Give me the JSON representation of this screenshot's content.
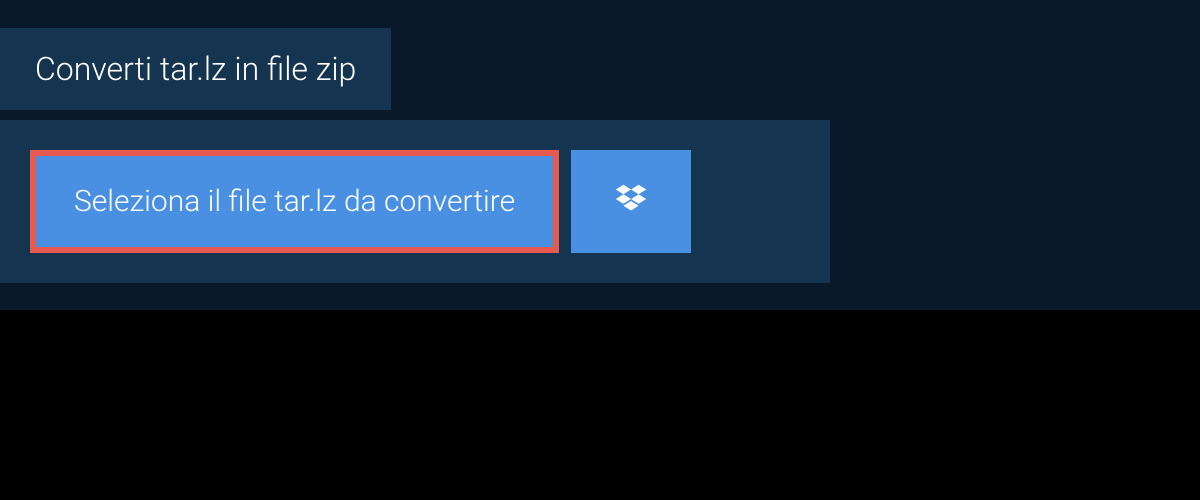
{
  "header": {
    "title": "Converti tar.lz in file zip"
  },
  "upload": {
    "select_label": "Seleziona il file tar.lz da convertire",
    "dropbox_icon": "dropbox-icon"
  },
  "colors": {
    "background": "#0a1929",
    "panel": "#14344f",
    "button_primary": "#4990e2",
    "button_border_highlight": "#e65a4f",
    "text": "#ffffff"
  }
}
